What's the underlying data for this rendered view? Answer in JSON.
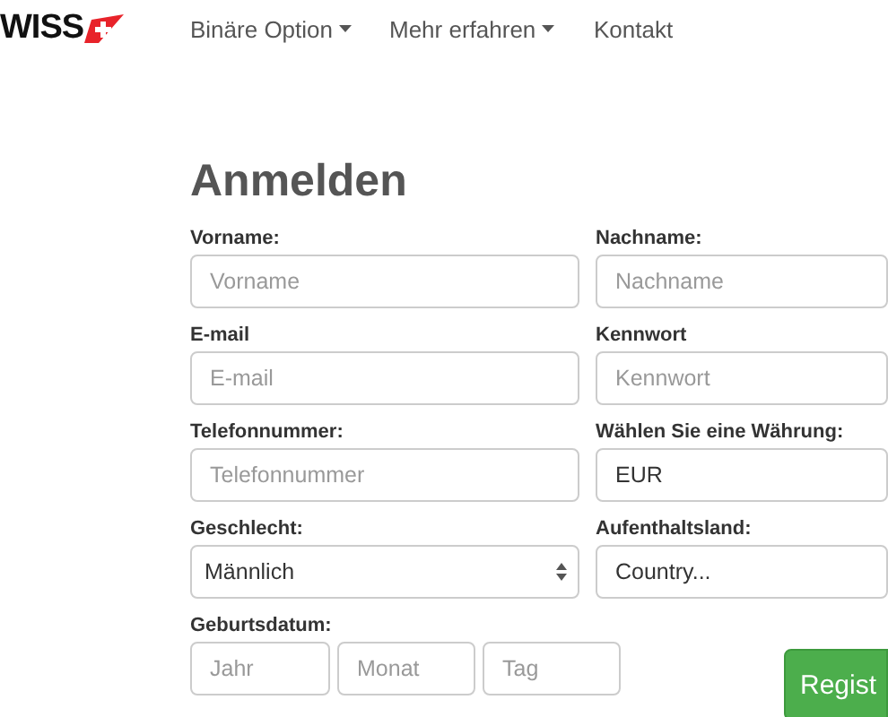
{
  "nav": {
    "logo": "WISS",
    "items": [
      {
        "label": "Binäre Option",
        "dropdown": true
      },
      {
        "label": "Mehr erfahren",
        "dropdown": true
      },
      {
        "label": "Kontakt",
        "dropdown": false
      }
    ]
  },
  "form": {
    "title": "Anmelden",
    "fields": [
      {
        "kind": "text",
        "label": "Vorname:",
        "placeholder": "Vorname"
      },
      {
        "kind": "text",
        "label": "Nachname:",
        "placeholder": "Nachname"
      },
      {
        "kind": "text",
        "label": "E-mail",
        "placeholder": "E-mail"
      },
      {
        "kind": "text",
        "label": "Kennwort",
        "placeholder": "Kennwort"
      },
      {
        "kind": "text",
        "label": "Telefonnummer:",
        "placeholder": "Telefonnummer"
      },
      {
        "kind": "text",
        "label": "Wählen Sie eine Währung:",
        "value": "EUR"
      },
      {
        "kind": "select",
        "label": "Geschlecht:",
        "value": "Männlich"
      },
      {
        "kind": "text",
        "label": "Aufenthaltsland:",
        "value": "Country..."
      },
      {
        "kind": "date",
        "label": "Geburtsdatum:",
        "parts": [
          {
            "placeholder": "Jahr"
          },
          {
            "placeholder": "Monat"
          },
          {
            "placeholder": "Tag"
          }
        ]
      }
    ],
    "submit": "Regist"
  }
}
